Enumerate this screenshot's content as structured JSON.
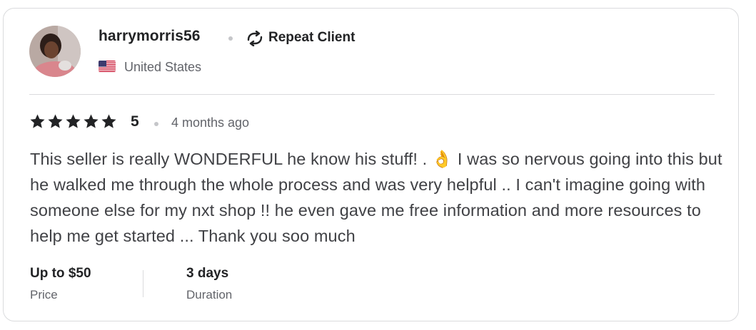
{
  "reviewer": {
    "username": "harrymorris56",
    "badge_label": "Repeat Client",
    "country": "United States",
    "avatar_icon": "user-avatar-photo",
    "flag_icon": "us-flag-icon"
  },
  "review": {
    "rating": "5",
    "stars_filled": 5,
    "stars_total": 5,
    "time_ago": "4 months ago",
    "text_before_emoji": "This seller is really WONDERFUL he know his stuff! . ",
    "emoji": "👌",
    "text_after_emoji": " I was so nervous going into this but he walked me through the whole process and was very helpful .. I can't imagine going with someone else for my nxt shop !! he even gave me free information and more resources to help me get started ... Thank you soo much"
  },
  "details": {
    "price_value": "Up to $50",
    "price_label": "Price",
    "duration_value": "3 days",
    "duration_label": "Duration"
  },
  "colors": {
    "star": "#222325",
    "text_primary": "#222325",
    "text_secondary": "#62646a",
    "border": "#dadbdd"
  }
}
